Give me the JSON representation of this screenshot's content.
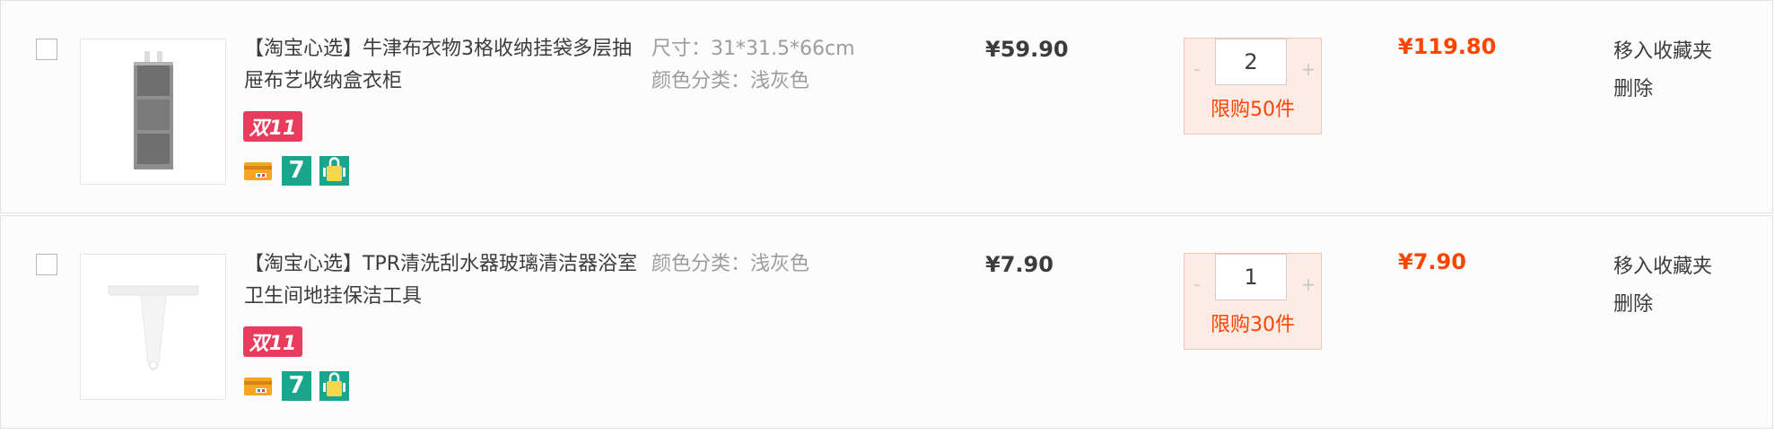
{
  "items": [
    {
      "title": "【淘宝心选】牛津布衣物3格收纳挂袋多层抽屉布艺收纳盒衣柜",
      "badge": "双11",
      "service_icons": [
        "credit-card-icon",
        "seven-day-return-icon",
        "bag-icon"
      ],
      "seven_label": "7",
      "sku_lines": [
        "尺寸：31*31.5*66cm",
        "颜色分类：浅灰色"
      ],
      "price": "¥59.90",
      "quantity": "2",
      "minus_label": "-",
      "plus_label": "+",
      "limit": "限购50件",
      "subtotal": "¥119.80",
      "favorite_label": "移入收藏夹",
      "delete_label": "删除",
      "thumbnail": "hanging-organizer-icon"
    },
    {
      "title": "【淘宝心选】TPR清洗刮水器玻璃清洁器浴室卫生间地挂保洁工具",
      "badge": "双11",
      "service_icons": [
        "credit-card-icon",
        "seven-day-return-icon",
        "bag-icon"
      ],
      "seven_label": "7",
      "sku_lines": [
        "颜色分类：浅灰色"
      ],
      "price": "¥7.90",
      "quantity": "1",
      "minus_label": "-",
      "plus_label": "+",
      "limit": "限购30件",
      "subtotal": "¥7.90",
      "favorite_label": "移入收藏夹",
      "delete_label": "删除",
      "thumbnail": "squeegee-icon"
    }
  ],
  "colors": {
    "accent": "#ff4400",
    "badge": "#e93b5c",
    "service_green": "#1aa68c",
    "muted_text": "#9c9c9c"
  }
}
